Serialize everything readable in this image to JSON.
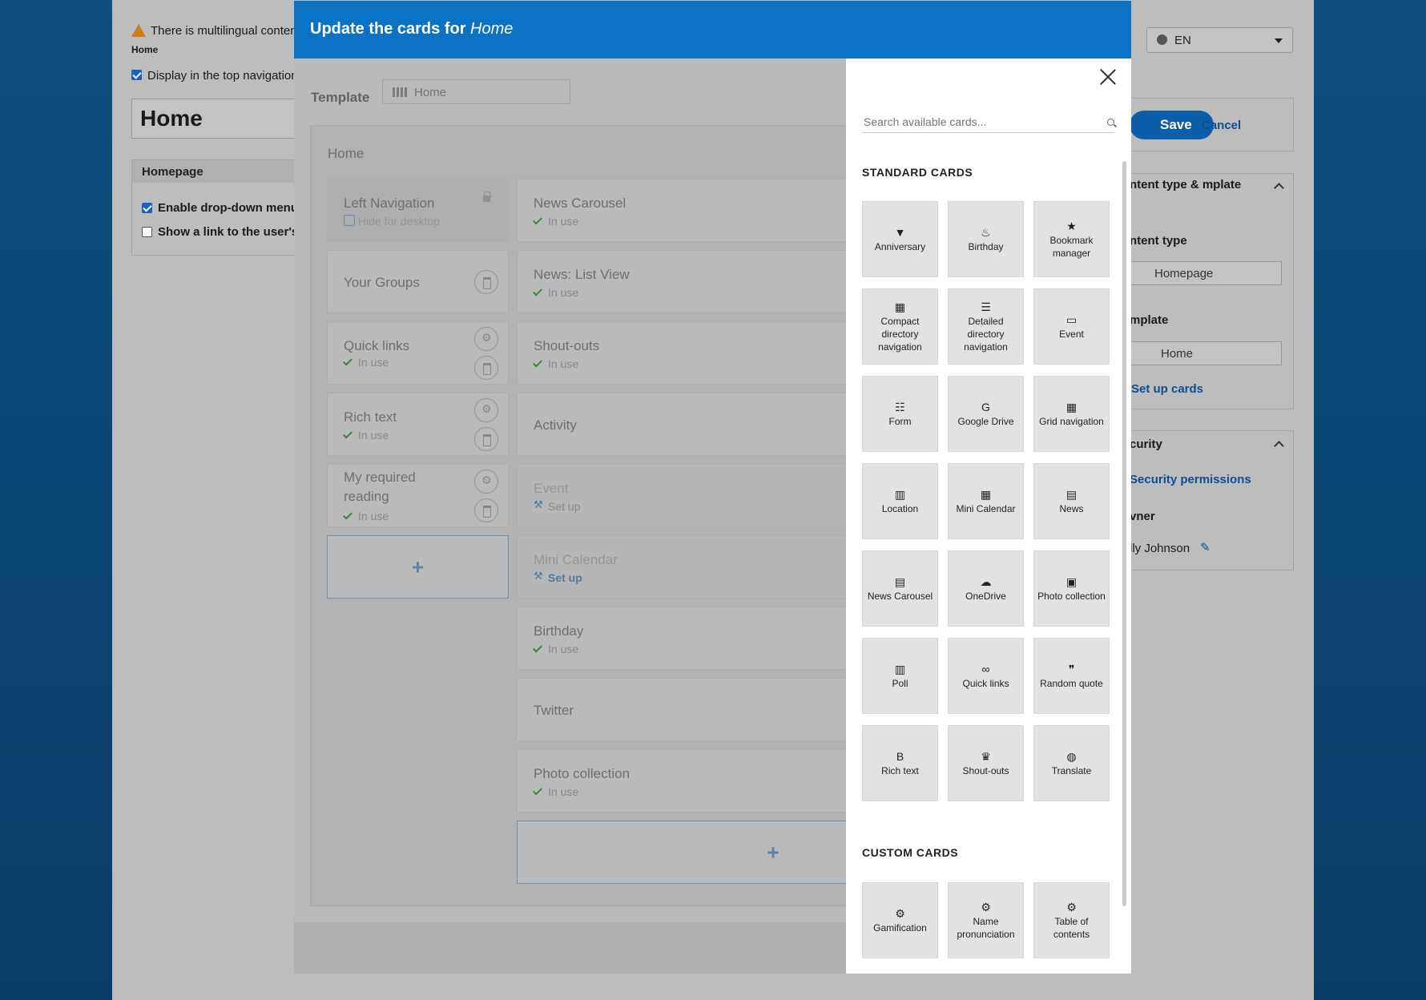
{
  "background": {
    "warning_text": "There is multilingual content",
    "crumb": "Home",
    "display_top_nav": "Display in the top navigation",
    "page_title": "Home",
    "homepage_section": {
      "header": "Homepage",
      "enable_dropdown": "Enable drop-down menu",
      "show_link": "Show a link to the user's"
    },
    "language": "EN",
    "save_label": "Save",
    "cancel_label": "Cancel",
    "content_panel": {
      "header": "ntent type & mplate",
      "content_type_label": "ntent type",
      "content_type_value": "Homepage",
      "template_label": "mplate",
      "template_value": "Home",
      "setup_cards": "Set up cards"
    },
    "security_panel": {
      "header": "curity",
      "permissions": "Security permissions",
      "owner_label": "vner",
      "owner_value": "lly Johnson"
    }
  },
  "modal": {
    "title_prefix": "Update the cards for ",
    "title_page": "Home",
    "template_label": "Template",
    "template_value": "Home",
    "canvas_title": "Home",
    "left_column": [
      {
        "name": "Left Navigation",
        "status": "Hide for desktop"
      },
      {
        "name": "Your Groups",
        "status": ""
      },
      {
        "name": "Quick links",
        "status": "In use"
      },
      {
        "name": "Rich text",
        "status": "In use"
      },
      {
        "name": "My required reading",
        "status": "In use"
      }
    ],
    "center_column": [
      {
        "name": "News Carousel",
        "status": "In use"
      },
      {
        "name": "News: List View",
        "status": "In use"
      },
      {
        "name": "Shout-outs",
        "status": "In use"
      },
      {
        "name": "Activity",
        "status": ""
      },
      {
        "name": "Event",
        "status": "Set up"
      },
      {
        "name": "Mini Calendar",
        "status": "Set up"
      },
      {
        "name": "Birthday",
        "status": "In use"
      },
      {
        "name": "Twitter",
        "status": ""
      },
      {
        "name": "Photo collection",
        "status": "In use"
      }
    ],
    "add_symbol": "+"
  },
  "drawer": {
    "search_placeholder": "Search available cards...",
    "standard_title": "STANDARD CARDS",
    "standard_cards": [
      {
        "label": "Anniversary",
        "icon": "▼"
      },
      {
        "label": "Birthday",
        "icon": "♨"
      },
      {
        "label": "Bookmark manager",
        "icon": "★"
      },
      {
        "label": "Compact directory navigation",
        "icon": "▦"
      },
      {
        "label": "Detailed directory navigation",
        "icon": "☰"
      },
      {
        "label": "Event",
        "icon": "▭"
      },
      {
        "label": "Form",
        "icon": "☷"
      },
      {
        "label": "Google Drive",
        "icon": "G"
      },
      {
        "label": "Grid navigation",
        "icon": "▦"
      },
      {
        "label": "Location",
        "icon": "▥"
      },
      {
        "label": "Mini Calendar",
        "icon": "▦"
      },
      {
        "label": "News",
        "icon": "▤"
      },
      {
        "label": "News Carousel",
        "icon": "▤"
      },
      {
        "label": "OneDrive",
        "icon": "☁"
      },
      {
        "label": "Photo collection",
        "icon": "▣"
      },
      {
        "label": "Poll",
        "icon": "▥"
      },
      {
        "label": "Quick links",
        "icon": "∞"
      },
      {
        "label": "Random quote",
        "icon": "❞"
      },
      {
        "label": "Rich text",
        "icon": "B"
      },
      {
        "label": "Shout-outs",
        "icon": "♛"
      },
      {
        "label": "Translate",
        "icon": "◍"
      }
    ],
    "custom_title": "CUSTOM CARDS",
    "custom_cards": [
      {
        "label": "Gamification",
        "icon": "⚙"
      },
      {
        "label": "Name pronunciation",
        "icon": "⚙"
      },
      {
        "label": "Table of contents",
        "icon": "⚙"
      }
    ]
  }
}
